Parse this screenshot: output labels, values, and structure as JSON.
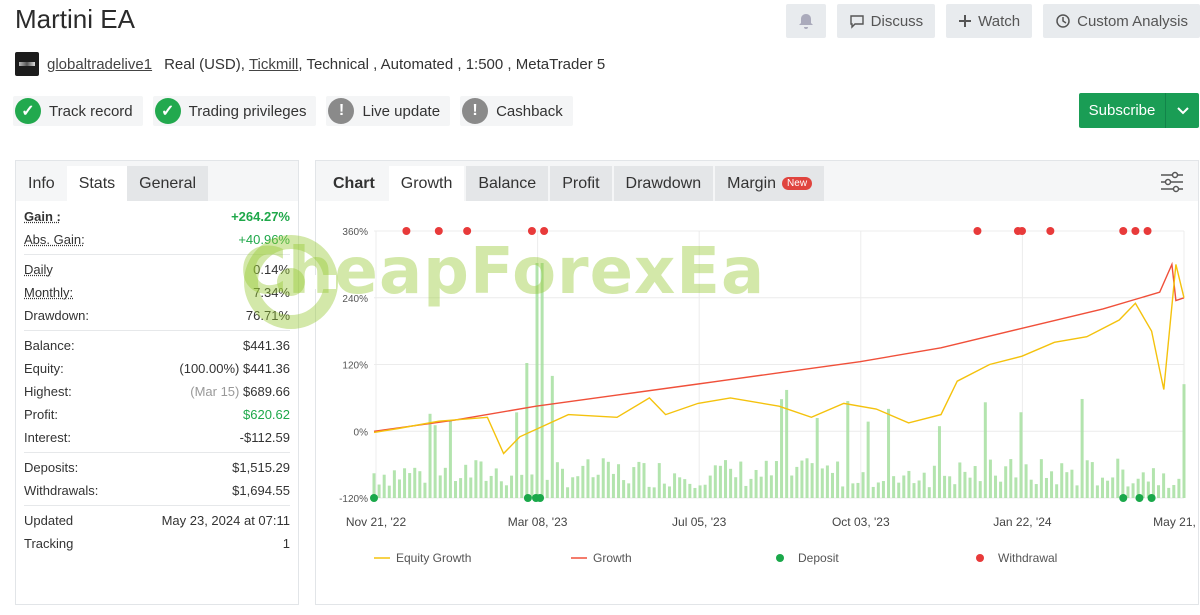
{
  "header": {
    "title": "Martini EA",
    "discuss_label": "Discuss",
    "watch_label": "Watch",
    "custom_analysis_label": "Custom Analysis"
  },
  "meta": {
    "username": "globaltradelive1",
    "account_type": "Real (USD),",
    "broker": "Tickmill",
    "details": ", Technical , Automated , 1:500 , MetaTrader 5"
  },
  "badges": [
    {
      "label": "Track record",
      "status": "ok"
    },
    {
      "label": "Trading privileges",
      "status": "ok"
    },
    {
      "label": "Live update",
      "status": "warn"
    },
    {
      "label": "Cashback",
      "status": "warn"
    }
  ],
  "subscribe_label": "Subscribe",
  "left_tabs": [
    "Info",
    "Stats",
    "General"
  ],
  "stats": {
    "gain_k": "Gain :",
    "gain_v": "+264.27%",
    "absgain_k": "Abs. Gain:",
    "absgain_v": "+40.96%",
    "daily_k": "Daily",
    "daily_v": "0.14%",
    "monthly_k": "Monthly:",
    "monthly_v": "7.34%",
    "drawdown_k": "Drawdown:",
    "drawdown_v": "76.71%",
    "balance_k": "Balance:",
    "balance_v": "$441.36",
    "equity_k": "Equity:",
    "equity_pct": "(100.00%)",
    "equity_v": "$441.36",
    "highest_k": "Highest:",
    "highest_date": "(Mar 15)",
    "highest_v": "$689.66",
    "profit_k": "Profit:",
    "profit_v": "$620.62",
    "interest_k": "Interest:",
    "interest_v": "-$112.59",
    "deposits_k": "Deposits:",
    "deposits_v": "$1,515.29",
    "withdrawals_k": "Withdrawals:",
    "withdrawals_v": "$1,694.55",
    "updated_k": "Updated",
    "updated_v": "May 23, 2024 at 07:11",
    "tracking_k": "Tracking",
    "tracking_v": "1"
  },
  "chart_tabs": [
    "Chart",
    "Growth",
    "Balance",
    "Profit",
    "Drawdown",
    "Margin"
  ],
  "new_badge": "New",
  "watermark": "CheapForexEa",
  "colors": {
    "growth": "#f0503a",
    "equity": "#f4c20d",
    "deposit": "#1aa84a",
    "withdrawal": "#e83a3a",
    "bars": "#a6dfa0",
    "accent": "#1a9d55"
  },
  "chart_data": {
    "type": "line",
    "x_ticks": [
      "Nov 21, '22",
      "Mar 08, '23",
      "Jul 05, '23",
      "Oct 03, '23",
      "Jan 22, '24",
      "May 21, '24"
    ],
    "y_ticks": [
      "360%",
      "240%",
      "120%",
      "0%",
      "-120%"
    ],
    "ylim": [
      -120,
      360
    ],
    "legend": [
      "Equity Growth",
      "Growth",
      "Deposit",
      "Withdrawal"
    ],
    "series": [
      {
        "name": "Growth",
        "points": [
          [
            0,
            0
          ],
          [
            0.1,
            20
          ],
          [
            0.2,
            45
          ],
          [
            0.3,
            65
          ],
          [
            0.4,
            85
          ],
          [
            0.5,
            105
          ],
          [
            0.6,
            125
          ],
          [
            0.7,
            150
          ],
          [
            0.8,
            185
          ],
          [
            0.9,
            220
          ],
          [
            0.97,
            250
          ],
          [
            0.985,
            300
          ],
          [
            0.99,
            235
          ],
          [
            1.0,
            240
          ]
        ]
      },
      {
        "name": "Equity Growth",
        "points": [
          [
            0,
            -2
          ],
          [
            0.03,
            5
          ],
          [
            0.08,
            18
          ],
          [
            0.14,
            25
          ],
          [
            0.16,
            -40
          ],
          [
            0.18,
            -10
          ],
          [
            0.24,
            30
          ],
          [
            0.3,
            25
          ],
          [
            0.34,
            60
          ],
          [
            0.36,
            30
          ],
          [
            0.4,
            50
          ],
          [
            0.44,
            60
          ],
          [
            0.5,
            45
          ],
          [
            0.54,
            25
          ],
          [
            0.58,
            50
          ],
          [
            0.62,
            40
          ],
          [
            0.66,
            15
          ],
          [
            0.7,
            30
          ],
          [
            0.72,
            90
          ],
          [
            0.76,
            120
          ],
          [
            0.8,
            135
          ],
          [
            0.84,
            160
          ],
          [
            0.88,
            170
          ],
          [
            0.92,
            200
          ],
          [
            0.94,
            230
          ],
          [
            0.96,
            180
          ],
          [
            0.97,
            110
          ],
          [
            0.975,
            75
          ],
          [
            0.99,
            300
          ],
          [
            1.0,
            240
          ]
        ]
      }
    ],
    "withdrawals_x": [
      0.04,
      0.08,
      0.115,
      0.195,
      0.21,
      0.745,
      0.795,
      0.8,
      0.835,
      0.925,
      0.94,
      0.955
    ],
    "deposits_x": [
      0.0,
      0.19,
      0.2,
      0.205,
      0.925,
      0.945,
      0.96
    ]
  }
}
